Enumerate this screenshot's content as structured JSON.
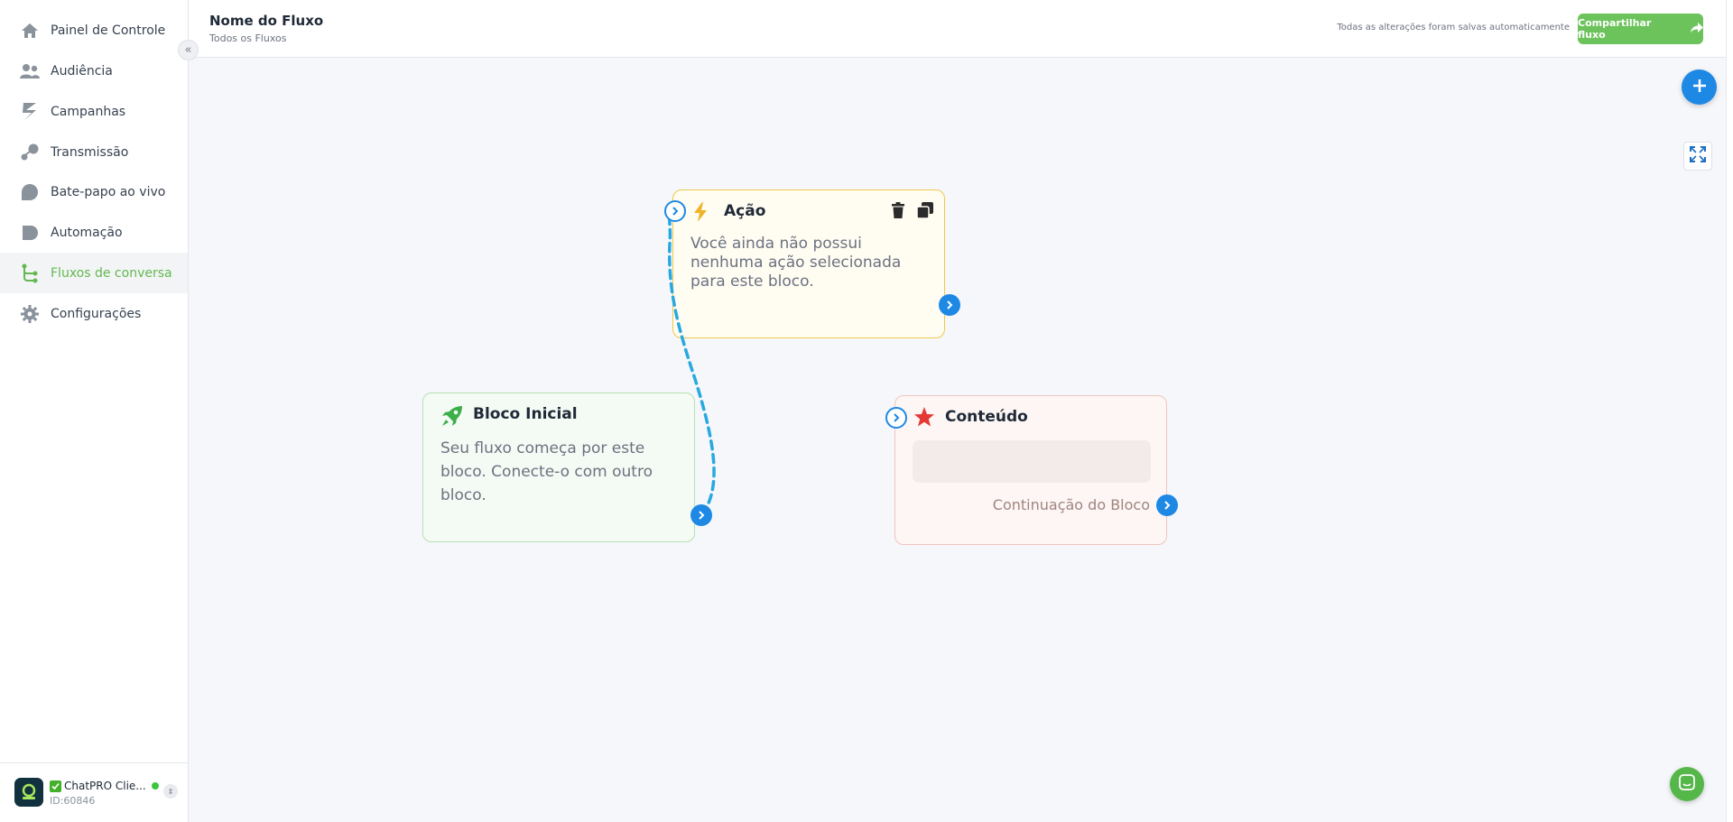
{
  "sidebar": {
    "items": [
      {
        "label": "Painel de Controle",
        "icon": "home-icon"
      },
      {
        "label": "Audiência",
        "icon": "users-icon"
      },
      {
        "label": "Campanhas",
        "icon": "campaign-icon"
      },
      {
        "label": "Transmissão",
        "icon": "broadcast-icon"
      },
      {
        "label": "Bate-papo ao vivo",
        "icon": "chat-bubble-icon"
      },
      {
        "label": "Automação",
        "icon": "automation-icon"
      },
      {
        "label": "Fluxos de conversa",
        "icon": "flow-icon",
        "active": true
      },
      {
        "label": "Configurações",
        "icon": "gear-icon"
      }
    ],
    "profile": {
      "name": "ChatPRO Clie...",
      "id": "ID:60846"
    }
  },
  "header": {
    "title": "Nome do Fluxo",
    "breadcrumb": "Todos os Fluxos",
    "save_status": "Todas as alterações foram salvas automaticamente",
    "share_label": "Compartilhar fluxo"
  },
  "blocks": {
    "action": {
      "title": "Ação",
      "text": "Você ainda não possui nenhuma ação selecionada para este bloco."
    },
    "start": {
      "title": "Bloco Inicial",
      "text": "Seu fluxo começa por este bloco. Conecte-o com outro bloco."
    },
    "content": {
      "title": "Conteúdo",
      "continuation": "Continuação do Bloco"
    }
  },
  "colors": {
    "accent_green": "#6cc35c",
    "accent_blue": "#1e88e5",
    "connector": "#29a8e0",
    "action_border": "#f0c94a",
    "content_star": "#e53935"
  }
}
